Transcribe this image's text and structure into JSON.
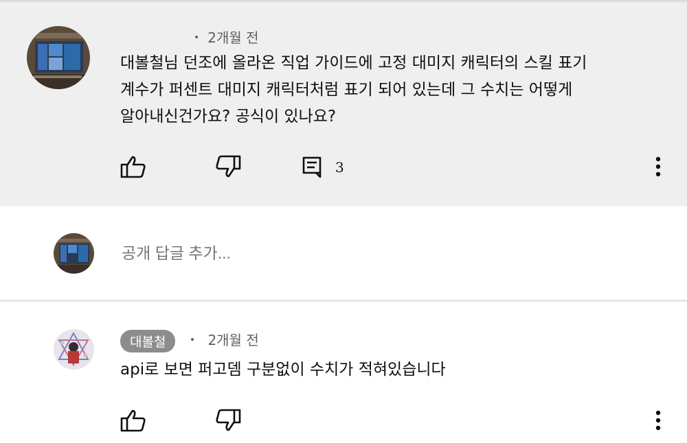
{
  "comment": {
    "time": "2개월 전",
    "lines": [
      "대볼철님 던조에 올라온 직업 가이드에 고정 대미지 캐릭터의 스킬 표기",
      "계수가 퍼센트 대미지 캐릭터처럼 표기 되어 있는데 그 수치는 어떻게",
      "알아내신건가요? 공식이 있나요?"
    ],
    "reply_count": "3",
    "icons": {
      "like": "thumbs-up-icon",
      "dislike": "thumbs-down-icon",
      "reply": "comment-icon",
      "more": "more-vert-icon"
    }
  },
  "reply_input": {
    "placeholder": "공개 답글 추가..."
  },
  "reply": {
    "author": "대볼철",
    "time": "2개월 전",
    "text": "api로 보면 퍼고뎀 구분없이 수치가 적혀있습니다"
  },
  "colors": {
    "highlight_bg": "#efefef",
    "secondary_text": "#606060",
    "chip_bg": "#8c8c8c"
  }
}
